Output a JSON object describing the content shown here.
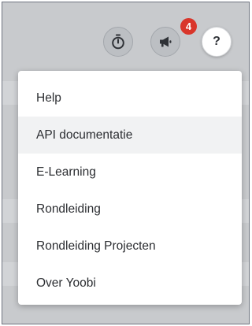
{
  "toolbar": {
    "timer_icon": "stopwatch-icon",
    "announcements_icon": "megaphone-icon",
    "notification_count": "4",
    "help_label": "?"
  },
  "help_menu": {
    "items": [
      {
        "label": "Help"
      },
      {
        "label": "API documentatie",
        "highlighted": true
      },
      {
        "label": "E-Learning"
      },
      {
        "label": "Rondleiding"
      },
      {
        "label": "Rondleiding Projecten"
      },
      {
        "label": "Over Yoobi"
      }
    ]
  },
  "colors": {
    "badge": "#d9362b",
    "backdrop": "#c8cacd",
    "menu_background": "#ffffff",
    "menu_hover": "#f1f2f3",
    "text": "#2b2d31"
  }
}
